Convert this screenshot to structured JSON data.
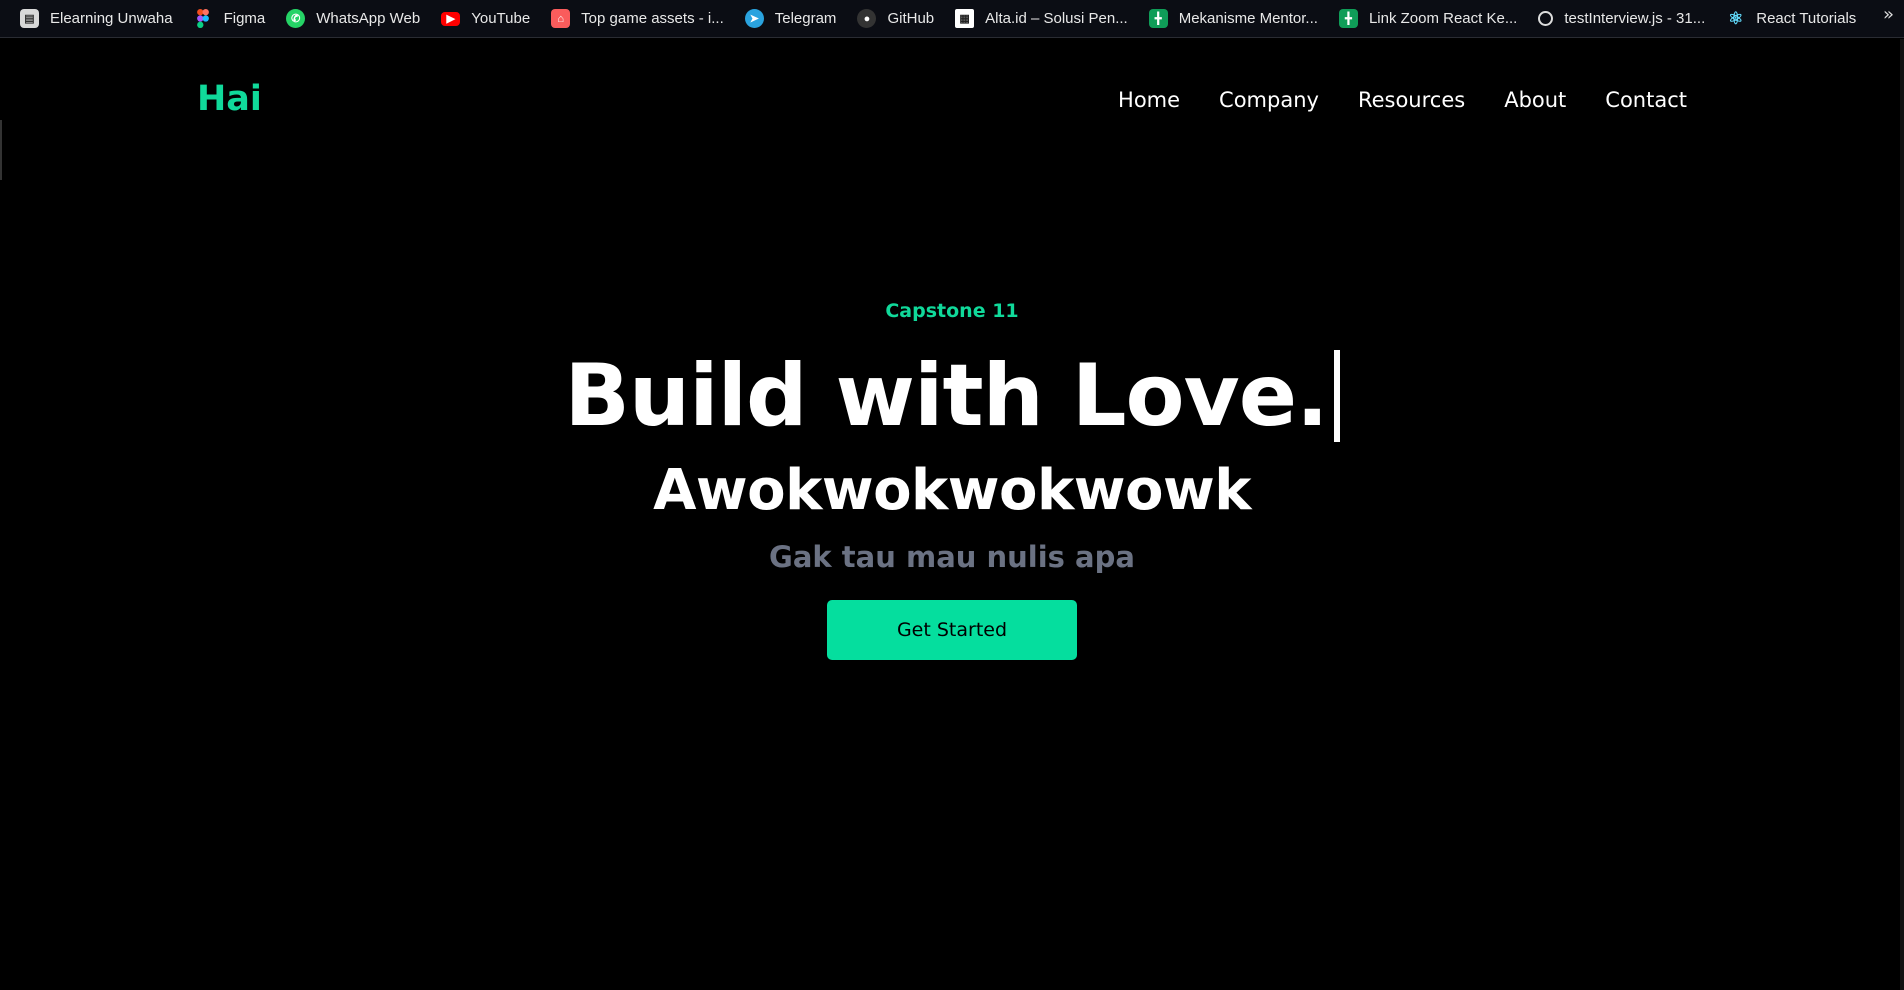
{
  "bookmarks": [
    {
      "label": "Elearning Unwaha",
      "icon": "elearning-icon",
      "color": "#cfcfcf"
    },
    {
      "label": "Figma",
      "icon": "figma-icon",
      "color": "#f24e1e"
    },
    {
      "label": "WhatsApp Web",
      "icon": "whatsapp-icon",
      "color": "#25d366"
    },
    {
      "label": "YouTube",
      "icon": "youtube-icon",
      "color": "#ff0000"
    },
    {
      "label": "Top game assets - i...",
      "icon": "itchio-icon",
      "color": "#fa5c5c"
    },
    {
      "label": "Telegram",
      "icon": "telegram-icon",
      "color": "#2aa3df"
    },
    {
      "label": "GitHub",
      "icon": "github-icon",
      "color": "#333333"
    },
    {
      "label": "Alta.id – Solusi Pen...",
      "icon": "alta-icon",
      "color": "#ffffff"
    },
    {
      "label": "Mekanisme Mentor...",
      "icon": "sheets-icon",
      "color": "#0f9d58"
    },
    {
      "label": "Link Zoom React Ke...",
      "icon": "sheets-icon",
      "color": "#0f9d58"
    },
    {
      "label": "testInterview.js - 31...",
      "icon": "codesandbox-icon",
      "color": "#dddddd"
    },
    {
      "label": "React Tutorials",
      "icon": "react-icon",
      "color": "#61dafb"
    }
  ],
  "bookmarks_overflow": "»",
  "navbar": {
    "brand": "Hai",
    "links": [
      "Home",
      "Company",
      "Resources",
      "About",
      "Contact"
    ]
  },
  "hero": {
    "eyebrow": "Capstone 11",
    "headline": "Build with Love.",
    "subheadline": "Awokwokwokwowk",
    "tagline": "Gak tau mau nulis apa",
    "cta_label": "Get Started"
  },
  "colors": {
    "accent": "#05de9e",
    "background": "#000000",
    "muted_text": "#6b7283"
  }
}
